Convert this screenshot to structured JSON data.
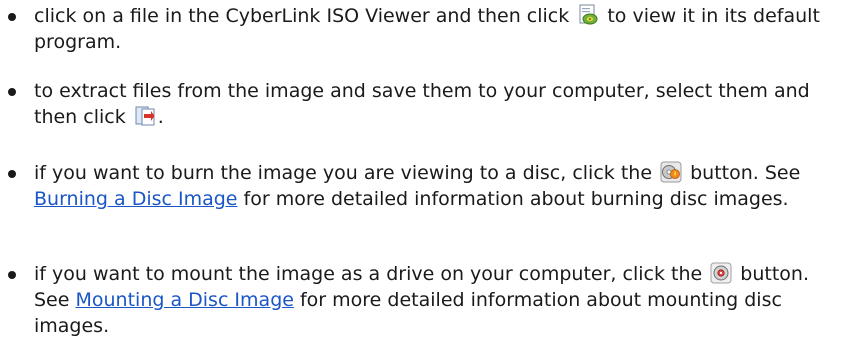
{
  "bullets": [
    {
      "before_icon": "click on a file in the CyberLink ISO Viewer and then click",
      "icon": "open-file-icon",
      "after_icon": " to view it in its default program."
    },
    {
      "before_icon": "to extract files from the image and save them to your computer, select them and then click",
      "icon": "extract-icon",
      "after_icon": "."
    },
    {
      "before_icon": "if you want to burn the image you are viewing to a disc, click the",
      "icon": "burn-disc-icon",
      "after_icon": " button. See ",
      "link": "Burning a Disc Image",
      "after_link": " for more detailed information about burning disc images."
    },
    {
      "before_icon": "if you want to mount the image as a drive on your computer, click the",
      "icon": "mount-disc-icon",
      "after_icon": " button. See ",
      "link": "Mounting a Disc Image",
      "after_link": " for more detailed information about mounting disc images."
    }
  ],
  "colors": {
    "text": "#1a1a1a",
    "link": "#1a56c8"
  }
}
